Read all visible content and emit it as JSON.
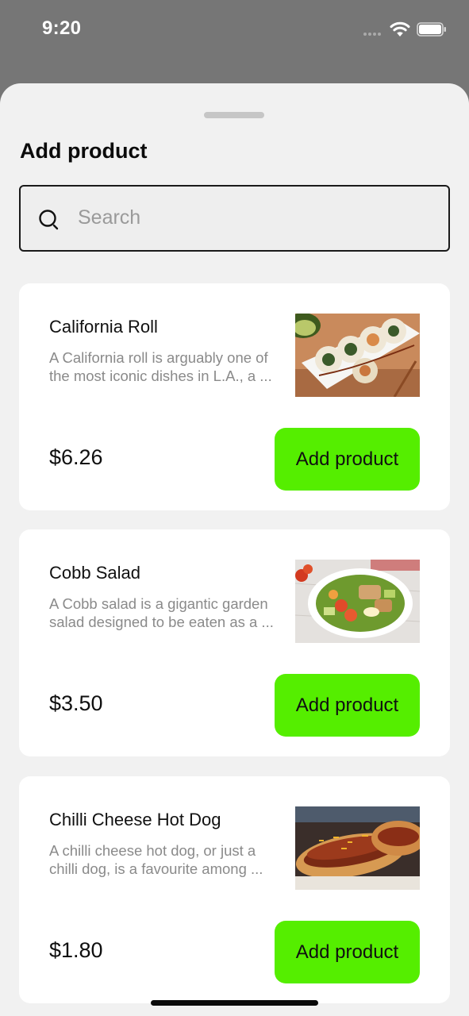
{
  "status_bar": {
    "time": "9:20",
    "icons": [
      "signal-dots-icon",
      "wifi-icon",
      "battery-icon"
    ]
  },
  "sheet": {
    "title": "Add product",
    "search": {
      "placeholder": "Search",
      "value": ""
    },
    "products": [
      {
        "name": "California Roll",
        "description_lines": [
          "A California roll is arguably one of",
          "the most iconic dishes in L.A., a ..."
        ],
        "price": "$6.26",
        "button_label": "Add product",
        "image": "california-roll-photo"
      },
      {
        "name": "Cobb Salad",
        "description_lines": [
          "A Cobb salad is a gigantic garden",
          "salad designed to be eaten as a ..."
        ],
        "price": "$3.50",
        "button_label": "Add product",
        "image": "cobb-salad-photo"
      },
      {
        "name": "Chilli Cheese Hot Dog",
        "description_lines": [
          "A chilli cheese hot dog, or just a",
          "chilli dog, is a favourite among ..."
        ],
        "price": "$1.80",
        "button_label": "Add product",
        "image": "hot-dog-photo"
      }
    ]
  },
  "colors": {
    "accent_button": "#55ee00",
    "backdrop": "#767676",
    "sheet_background": "#f1f1f1",
    "card_background": "#ffffff",
    "description_text": "#8a8a8a"
  }
}
